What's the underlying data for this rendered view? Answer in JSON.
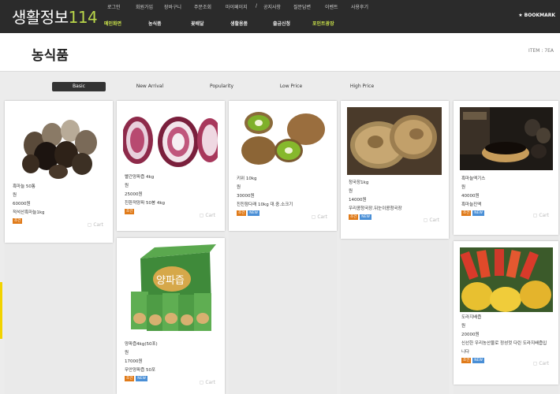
{
  "site": {
    "logo_main": "생활정보",
    "logo_num": "114",
    "bookmark": "★ BOOKMARK"
  },
  "util_links": [
    "로그인",
    "회원가입",
    "장바구니",
    "주문조회",
    "마이페이지",
    "/",
    "공지사항",
    "질문답변",
    "이벤트",
    "사용후기"
  ],
  "main_nav": [
    "메인화면",
    "농식품",
    "꽃배달",
    "생활용품",
    "출금신청",
    "포인트광장"
  ],
  "page": {
    "title": "농식품",
    "item_count": "ITEM : 7EA"
  },
  "sort_tabs": [
    "Basic",
    "New Arrival",
    "Popularity",
    "Low Price",
    "High Price"
  ],
  "cart_label": "Cart",
  "products": [
    {
      "name": "흑마늘 50통",
      "unit": "원",
      "price": "60000원",
      "desc": "적석산흑마늘1kg",
      "tags": [
        "조건"
      ],
      "icon": "black-garlic"
    },
    {
      "name": "빨간양파즙 4kg",
      "unit": "원",
      "price": "25000원",
      "desc": "친환적양파 50봉 4kg",
      "tags": [
        "조건"
      ],
      "icon": "red-onion"
    },
    {
      "name": "키위 10kg",
      "unit": "원",
      "price": "30000원",
      "desc": "친친참다래 10kg 대.중.소크기",
      "tags": [
        "조건",
        "NEW"
      ],
      "icon": "kiwi"
    },
    {
      "name": "청국장1kg",
      "unit": "원",
      "price": "14000원",
      "desc": "우리콩청국장.뒤눈이콩청국장",
      "tags": [
        "조건",
        "NEW"
      ],
      "icon": "cheonggukjang"
    },
    {
      "name": "흑마늘엑기스",
      "unit": "원",
      "price": "40000원",
      "desc": "흑마늘진액",
      "tags": [
        "조건",
        "NEW"
      ],
      "icon": "garlic-extract"
    },
    {
      "name": "양파즙4kg(50포)",
      "unit": "원",
      "price": "17000원",
      "desc": "무안양파즙 50포",
      "tags": [
        "조건",
        "NEW"
      ],
      "icon": "onion-juice-box"
    },
    {
      "name": "도라지배즙",
      "unit": "원",
      "price": "20000원",
      "desc": "신선한 우리농산물로 정성껏 다린 도라지배즙입니다",
      "tags": [
        "조건",
        "NEW"
      ],
      "icon": "bellflower-pear-juice"
    }
  ],
  "colors": {
    "topbar": "#2b2b2b",
    "accent": "#b9d64a",
    "tag_orange": "#e07b1a",
    "tag_blue": "#4a8fd6"
  }
}
